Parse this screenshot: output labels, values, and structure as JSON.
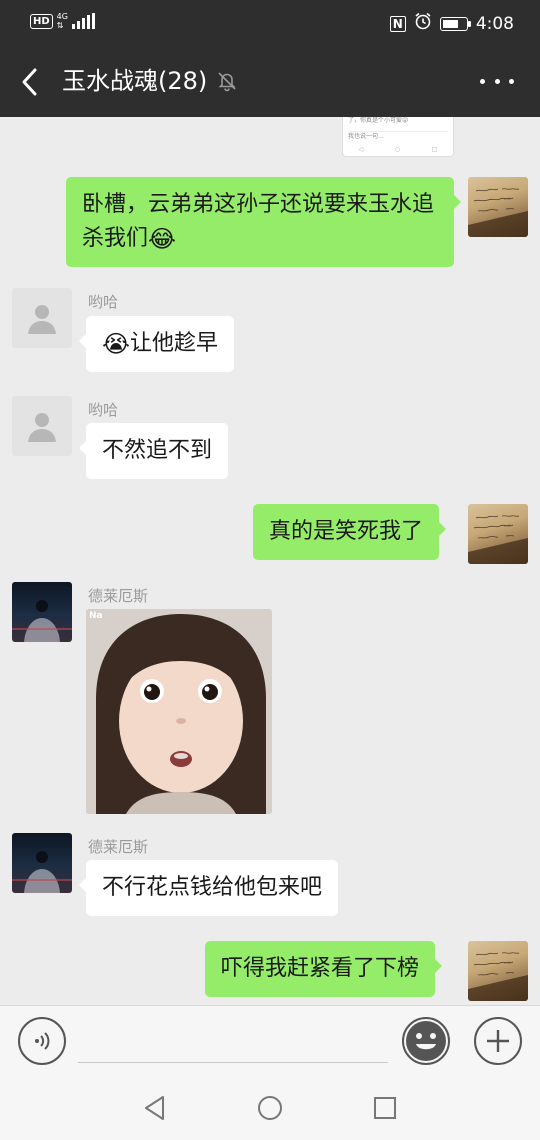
{
  "status_bar": {
    "hd": "HD",
    "network": "4G",
    "time": "4:08",
    "battery_level": 0.7
  },
  "header": {
    "title": "玉水战魂(28)",
    "muted": true
  },
  "snippet": {
    "line1": "了，你真是个小可爱😜",
    "line2": "我也说一句..."
  },
  "messages": [
    {
      "side": "right",
      "text": "卧槽，云弟弟这孙子还说要来玉水追杀我们",
      "emoji": "😂"
    },
    {
      "side": "left",
      "sender": "哟哈",
      "emoji": "😭",
      "text": "让他趁早"
    },
    {
      "side": "left",
      "sender": "哟哈",
      "text": "不然追不到"
    },
    {
      "side": "right",
      "text": "真的是笑死我了"
    },
    {
      "side": "left",
      "sender": "德莱厄斯",
      "sticker_tag": "Na"
    },
    {
      "side": "left",
      "sender": "德莱厄斯",
      "text": "不行花点钱给他包来吧"
    },
    {
      "side": "right",
      "text": "吓得我赶紧看了下榜"
    }
  ],
  "colors": {
    "header_bg": "#2e2e2e",
    "chat_bg": "#ececec",
    "self_bubble": "#95ec69",
    "other_bubble": "#ffffff"
  }
}
